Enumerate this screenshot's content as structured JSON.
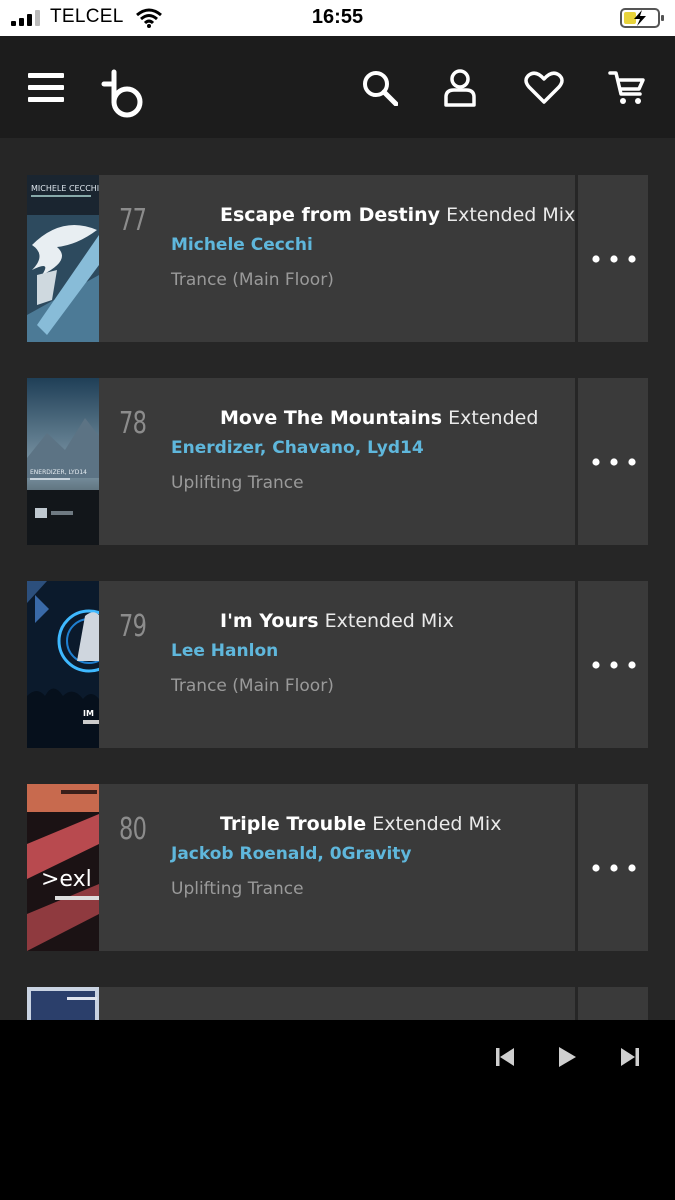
{
  "status_bar": {
    "carrier": "TELCEL",
    "time": "16:55"
  },
  "header": {
    "icons": [
      "menu-icon",
      "logo-icon",
      "search-icon",
      "account-icon",
      "heart-icon",
      "cart-icon"
    ]
  },
  "tracks": [
    {
      "rank": "77",
      "title": "Escape from Destiny",
      "mix": "Extended Mix",
      "artists": "Michele Cecchi",
      "genre": "Trance (Main Floor)",
      "cover_text": "MICHELE CECCHI"
    },
    {
      "rank": "78",
      "title": "Move The Mountains",
      "mix": "Extended",
      "artists": "Enerdizer, Chavano, Lyd14",
      "genre": "Uplifting Trance",
      "cover_text": "ENERDIZER, LYD14"
    },
    {
      "rank": "79",
      "title": "I'm Yours",
      "mix": "Extended Mix",
      "artists": "Lee Hanlon",
      "genre": "Trance (Main Floor)",
      "cover_text": "IM"
    },
    {
      "rank": "80",
      "title": "Triple Trouble",
      "mix": "Extended Mix",
      "artists": "Jackob Roenald, 0Gravity",
      "genre": "Uplifting Trance",
      "cover_text": ">exl"
    }
  ],
  "player": {
    "icons": [
      "previous-icon",
      "play-icon",
      "next-icon"
    ]
  },
  "colors": {
    "accent": "#5fb7dc",
    "row_bg": "#3a3a3a",
    "page_bg": "#262626",
    "header_bg": "#1c1c1c"
  }
}
